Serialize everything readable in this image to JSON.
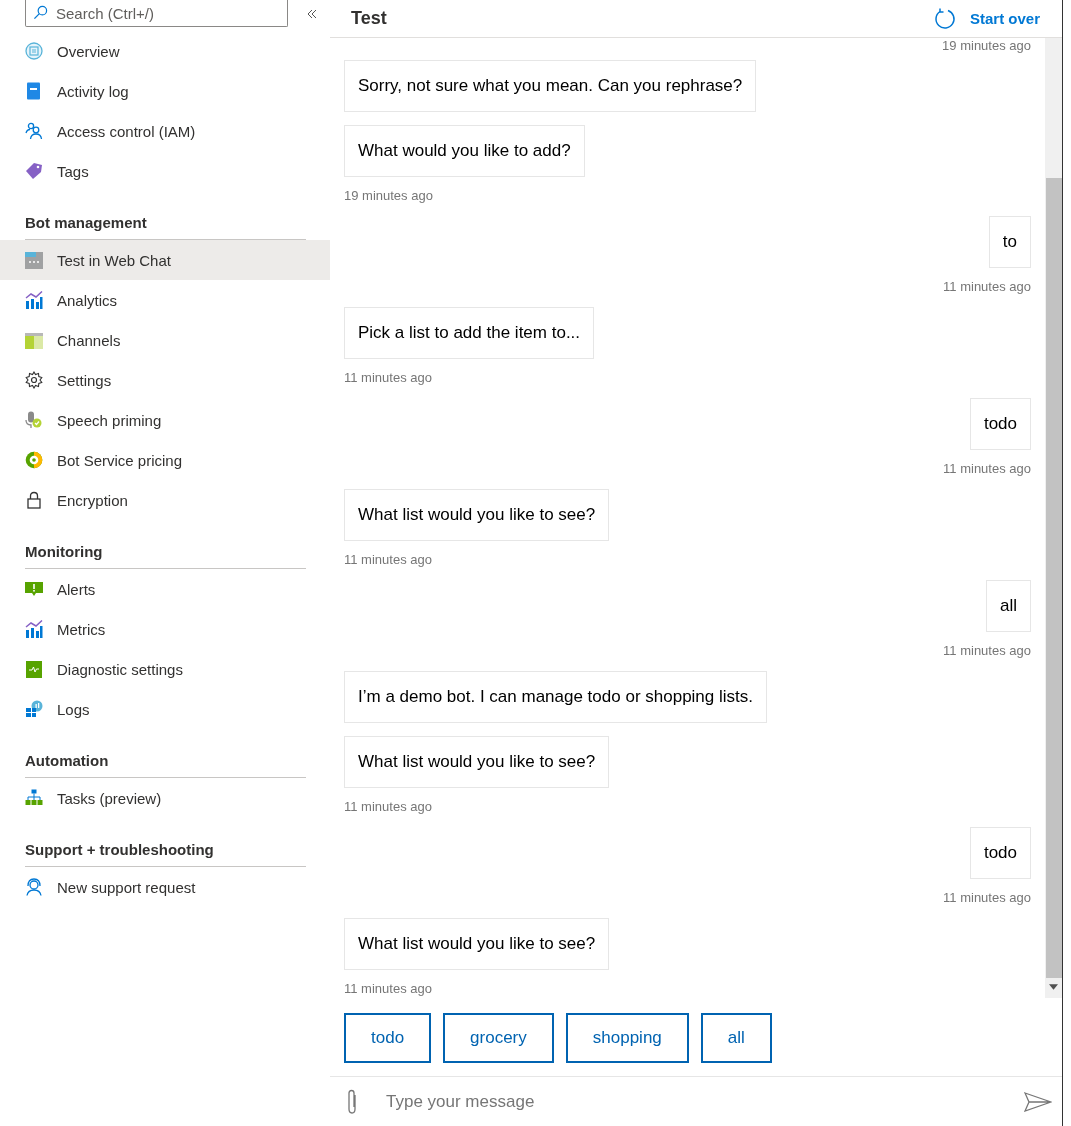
{
  "sidebar": {
    "search": {
      "placeholder": "Search (Ctrl+/)"
    },
    "groups": [
      {
        "items": [
          {
            "label": "Overview",
            "kind": "overview",
            "selected": false
          },
          {
            "label": "Activity log",
            "kind": "log",
            "selected": false
          },
          {
            "label": "Access control (IAM)",
            "kind": "people",
            "selected": false
          },
          {
            "label": "Tags",
            "kind": "tag",
            "selected": false
          }
        ]
      },
      {
        "heading": "Bot management",
        "items": [
          {
            "label": "Test in Web Chat",
            "kind": "webchat",
            "selected": true
          },
          {
            "label": "Analytics",
            "kind": "chart",
            "selected": false
          },
          {
            "label": "Channels",
            "kind": "channels",
            "selected": false
          },
          {
            "label": "Settings",
            "kind": "gear",
            "selected": false
          },
          {
            "label": "Speech priming",
            "kind": "mic",
            "selected": false
          },
          {
            "label": "Bot Service pricing",
            "kind": "pricing",
            "selected": false
          },
          {
            "label": "Encryption",
            "kind": "lock",
            "selected": false
          }
        ]
      },
      {
        "heading": "Monitoring",
        "items": [
          {
            "label": "Alerts",
            "kind": "alert",
            "selected": false
          },
          {
            "label": "Metrics",
            "kind": "chart",
            "selected": false
          },
          {
            "label": "Diagnostic settings",
            "kind": "diag",
            "selected": false
          },
          {
            "label": "Logs",
            "kind": "logs",
            "selected": false
          }
        ]
      },
      {
        "heading": "Automation",
        "items": [
          {
            "label": "Tasks (preview)",
            "kind": "tasks",
            "selected": false
          }
        ]
      },
      {
        "heading": "Support + troubleshooting",
        "items": [
          {
            "label": "New support request",
            "kind": "support",
            "selected": false
          }
        ]
      }
    ]
  },
  "chat": {
    "title": "Test",
    "start_over": "Start over",
    "activities": [
      {
        "kind": "user_time",
        "text": "19 minutes ago"
      },
      {
        "kind": "bot_message",
        "text": "Sorry, not sure what you mean. Can you rephrase?"
      },
      {
        "kind": "bot_message",
        "text": "What would you like to add?"
      },
      {
        "kind": "bot_time",
        "text": "19 minutes ago"
      },
      {
        "kind": "user_message",
        "text": "to"
      },
      {
        "kind": "user_time",
        "text": "11 minutes ago"
      },
      {
        "kind": "bot_message",
        "text": "Pick a list to add the item to..."
      },
      {
        "kind": "bot_time",
        "text": "11 minutes ago"
      },
      {
        "kind": "user_message",
        "text": "todo"
      },
      {
        "kind": "user_time",
        "text": "11 minutes ago"
      },
      {
        "kind": "bot_message",
        "text": "What list would you like to see?"
      },
      {
        "kind": "bot_time",
        "text": "11 minutes ago"
      },
      {
        "kind": "user_message",
        "text": "all"
      },
      {
        "kind": "user_time",
        "text": "11 minutes ago"
      },
      {
        "kind": "bot_message",
        "text": "I’m a demo bot. I can manage todo or shopping lists."
      },
      {
        "kind": "bot_message",
        "text": "What list would you like to see?"
      },
      {
        "kind": "bot_time",
        "text": "11 minutes ago"
      },
      {
        "kind": "user_message",
        "text": "todo"
      },
      {
        "kind": "user_time",
        "text": "11 minutes ago"
      },
      {
        "kind": "bot_message",
        "text": "What list would you like to see?"
      },
      {
        "kind": "bot_time",
        "text": "11 minutes ago"
      }
    ],
    "suggested_actions": [
      "todo",
      "grocery",
      "shopping",
      "all"
    ],
    "input": {
      "placeholder": "Type your message"
    }
  }
}
